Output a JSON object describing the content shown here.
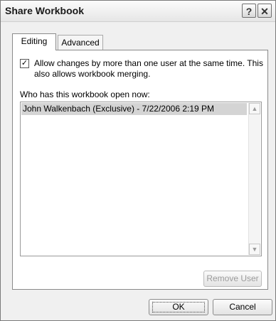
{
  "window": {
    "title": "Share Workbook"
  },
  "titlebar_buttons": {
    "help": "?",
    "close": "✕"
  },
  "tabs": [
    {
      "label": "Editing",
      "active": true
    },
    {
      "label": "Advanced",
      "active": false
    }
  ],
  "editing": {
    "allow_checkbox": {
      "checked": true,
      "mark": "✓",
      "label": "Allow changes by more than one user at the same time.  This also allows workbook merging."
    },
    "who_label": "Who has this workbook open now:",
    "users": [
      "John Walkenbach (Exclusive) - 7/22/2006 2:19 PM"
    ],
    "scroll_up": "▲",
    "scroll_down": "▼",
    "remove_user_label": "Remove User"
  },
  "footer": {
    "ok_label": "OK",
    "cancel_label": "Cancel"
  }
}
